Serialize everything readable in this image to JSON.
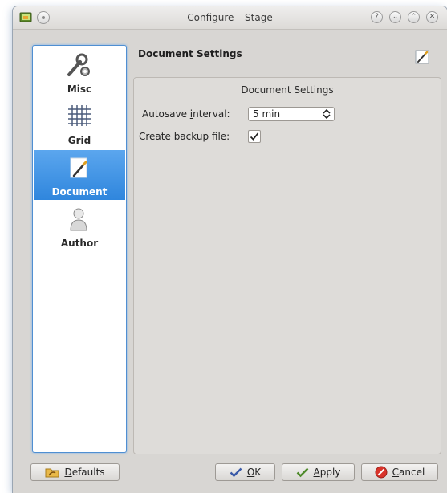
{
  "window": {
    "title": "Configure – Stage"
  },
  "sidebar": {
    "items": [
      {
        "id": "misc",
        "label": "Misc",
        "icon": "wrench-gear-icon",
        "selected": false
      },
      {
        "id": "grid",
        "label": "Grid",
        "icon": "grid-icon",
        "selected": false
      },
      {
        "id": "document",
        "label": "Document",
        "icon": "document-pen-icon",
        "selected": true
      },
      {
        "id": "author",
        "label": "Author",
        "icon": "person-icon",
        "selected": false
      }
    ]
  },
  "page": {
    "header": "Document Settings",
    "group_title": "Document Settings",
    "autosave_label_pre": "Autosave ",
    "autosave_label_key": "i",
    "autosave_label_post": "nterval:",
    "autosave_value": "5 min",
    "backup_label_pre": "Create ",
    "backup_label_key": "b",
    "backup_label_post": "ackup file:",
    "backup_checked": true
  },
  "buttons": {
    "defaults_key": "D",
    "defaults_rest": "efaults",
    "ok_key": "O",
    "ok_rest": "K",
    "apply_key": "A",
    "apply_rest": "pply",
    "cancel_key": "C",
    "cancel_rest": "ancel"
  },
  "colors": {
    "accent": "#3a8ee6",
    "window_bg": "#d8d6d3",
    "selected_text": "#ffffff"
  }
}
